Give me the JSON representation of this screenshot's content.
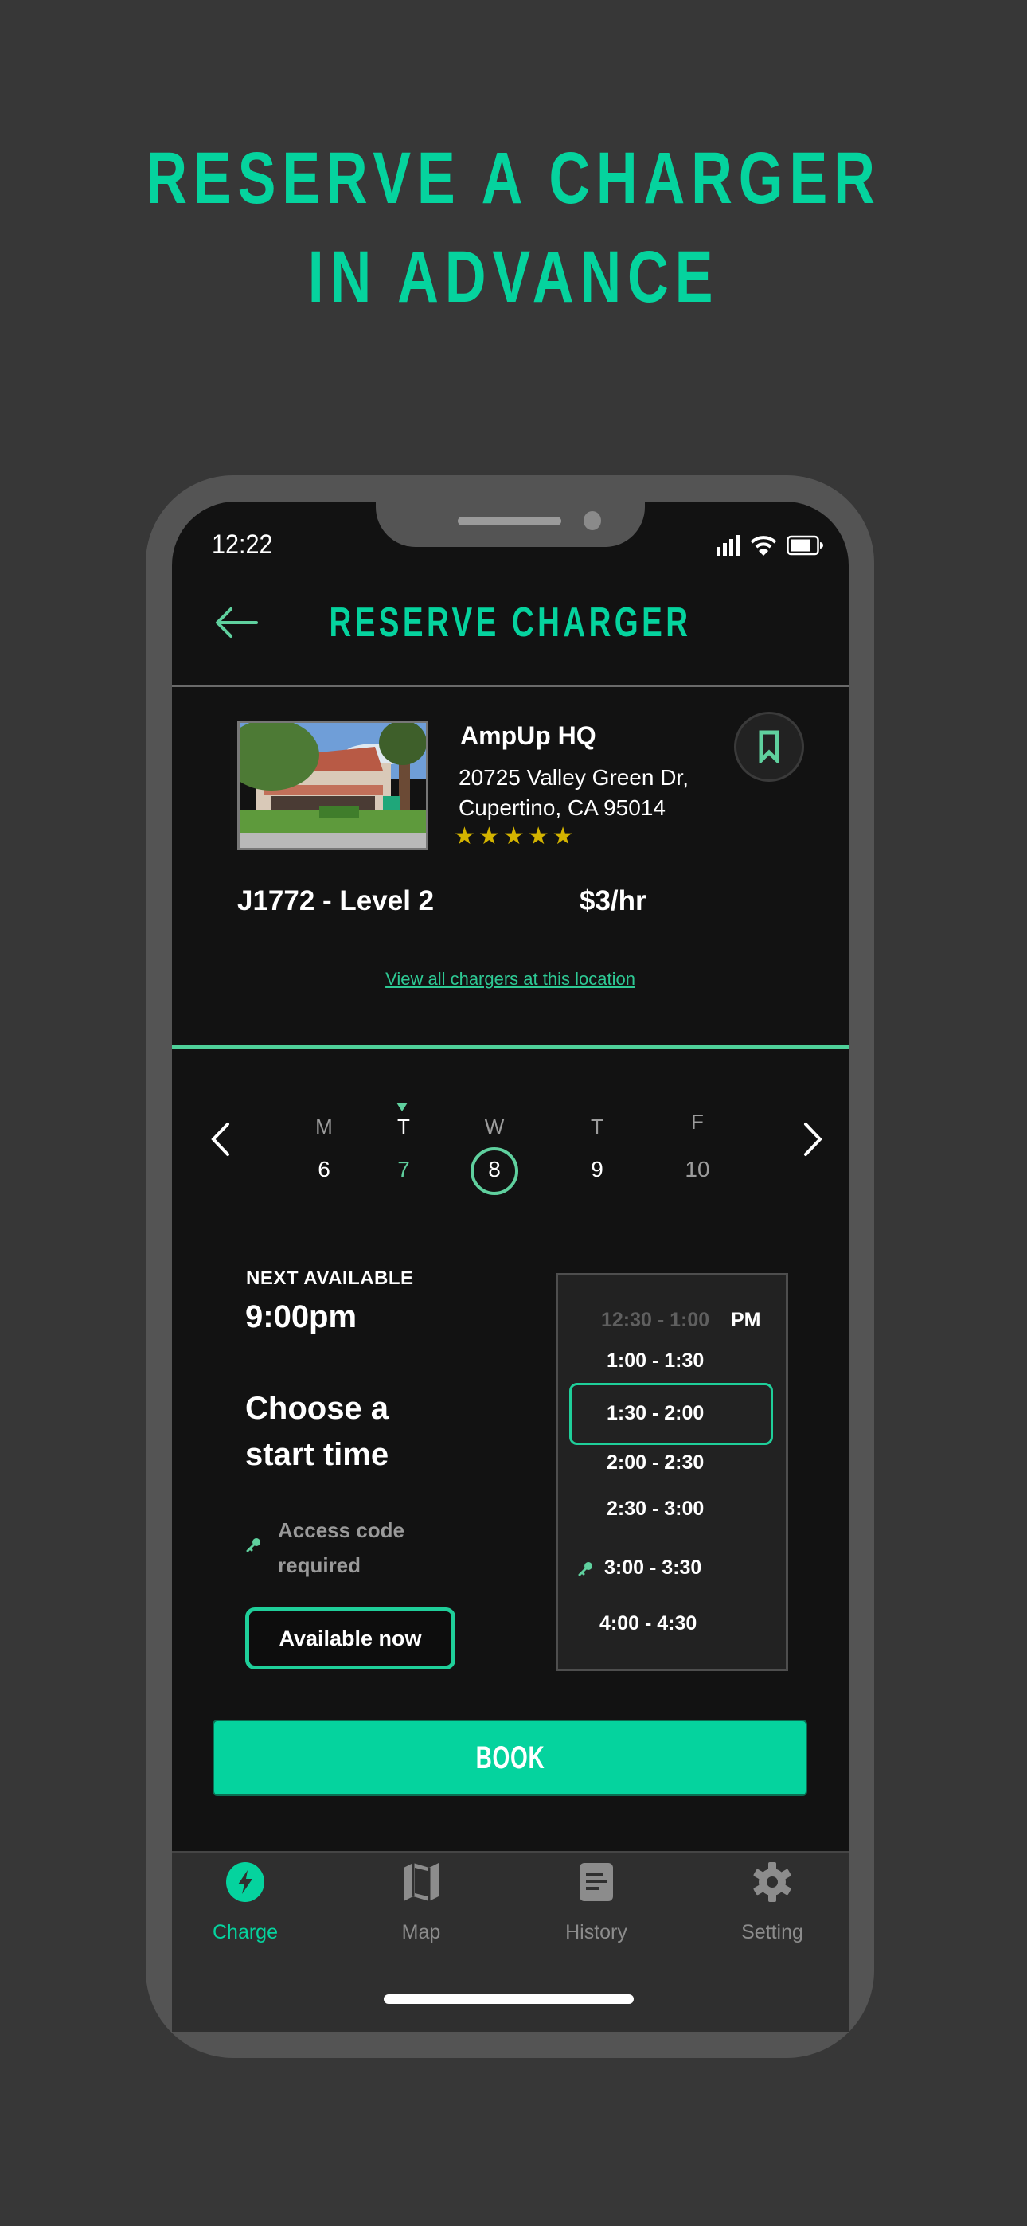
{
  "marketing": {
    "headline_line1": "RESERVE A CHARGER",
    "headline_line2": "IN ADVANCE"
  },
  "status_bar": {
    "time": "12:22",
    "icons": [
      "cellular-signal-icon",
      "wifi-icon",
      "battery-icon"
    ]
  },
  "header": {
    "back_icon": "arrow-left-icon",
    "title": "RESERVE CHARGER"
  },
  "location": {
    "name": "AmpUp HQ",
    "address_line1": "20725 Valley Green Dr,",
    "address_line2": "Cupertino, CA 95014",
    "rating": 5,
    "rating_max": 5,
    "bookmark_icon": "bookmark-icon"
  },
  "charger": {
    "type": "J1772 - Level 2",
    "price": "$3/hr",
    "view_all_link": "View all chargers at this location"
  },
  "date_picker": {
    "prev_icon": "chevron-left-icon",
    "next_icon": "chevron-right-icon",
    "days": [
      {
        "dow": "M",
        "num": "6",
        "state": "normal"
      },
      {
        "dow": "T",
        "num": "7",
        "state": "today"
      },
      {
        "dow": "W",
        "num": "8",
        "state": "selected"
      },
      {
        "dow": "T",
        "num": "9",
        "state": "normal"
      },
      {
        "dow": "F",
        "num": "10",
        "state": "muted"
      }
    ]
  },
  "availability": {
    "next_available_label": "NEXT AVAILABLE",
    "next_available_time": "9:00pm",
    "choose_title_line1": "Choose a",
    "choose_title_line2": "start time",
    "access_code_line1": "Access code",
    "access_code_line2": "required",
    "available_now_button": "Available now"
  },
  "time_slots": {
    "period": "PM",
    "slots": [
      {
        "label": "12:30 - 1:00",
        "state": "disabled",
        "access_code": false
      },
      {
        "label": "1:00 - 1:30",
        "state": "available",
        "access_code": false
      },
      {
        "label": "1:30 - 2:00",
        "state": "selected",
        "access_code": false
      },
      {
        "label": "2:00 - 2:30",
        "state": "available",
        "access_code": false
      },
      {
        "label": "2:30 - 3:00",
        "state": "available",
        "access_code": false
      },
      {
        "label": "3:00 - 3:30",
        "state": "available",
        "access_code": true
      },
      {
        "label": "4:00 - 4:30",
        "state": "available",
        "access_code": false
      }
    ]
  },
  "book_button": "BOOK",
  "tab_bar": {
    "items": [
      {
        "label": "Charge",
        "icon": "lightning-bolt-icon",
        "active": true
      },
      {
        "label": "Map",
        "icon": "map-icon",
        "active": false
      },
      {
        "label": "History",
        "icon": "document-list-icon",
        "active": false
      },
      {
        "label": "Setting",
        "icon": "gear-icon",
        "active": false
      }
    ]
  },
  "colors": {
    "accent": "#05d39e",
    "accent_soft": "#5fd09e",
    "star": "#d4b400",
    "background": "#373737",
    "screen": "#121212"
  }
}
